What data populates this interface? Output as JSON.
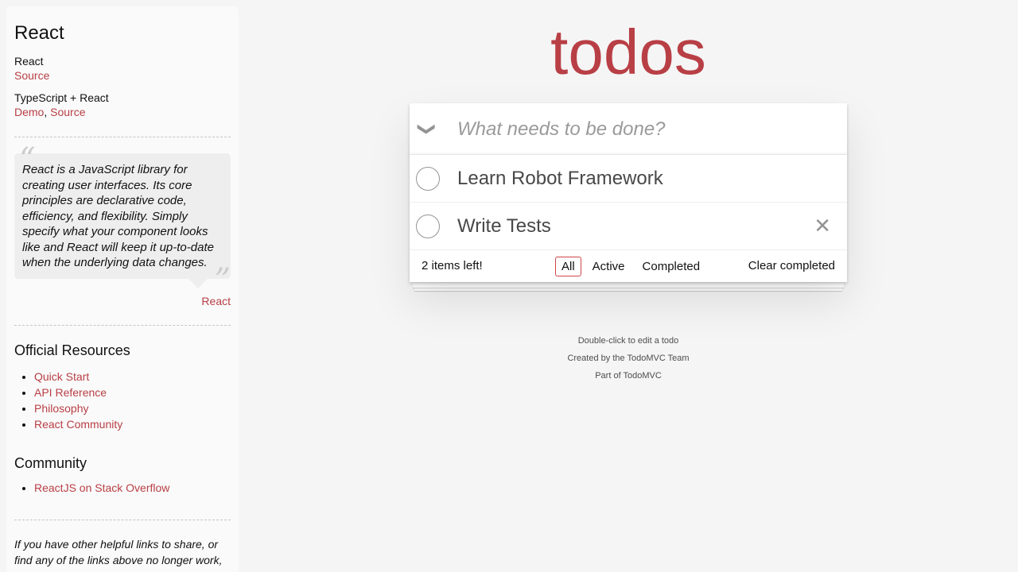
{
  "sidebar": {
    "title": "React",
    "examples": [
      {
        "name": "React",
        "links": [
          "Source"
        ]
      },
      {
        "name": "TypeScript + React",
        "links": [
          "Demo",
          "Source"
        ]
      }
    ],
    "quote": {
      "text": "React is a JavaScript library for creating user interfaces. Its core principles are declarative code, efficiency, and flexibility. Simply specify what your component looks like and React will keep it up-to-date when the underlying data changes.",
      "source": "React"
    },
    "official_resources": {
      "heading": "Official Resources",
      "items": [
        "Quick Start",
        "API Reference",
        "Philosophy",
        "React Community"
      ]
    },
    "community": {
      "heading": "Community",
      "items": [
        "ReactJS on Stack Overflow"
      ]
    },
    "footer_note": "If you have other helpful links to share, or find any of the links above no longer work, please let us know."
  },
  "app": {
    "title": "todos",
    "new_todo_placeholder": "What needs to be done?",
    "todos": [
      {
        "label": "Learn Robot Framework",
        "completed": false
      },
      {
        "label": "Write Tests",
        "completed": false
      }
    ],
    "footer": {
      "count": "2 items left!",
      "filters": [
        "All",
        "Active",
        "Completed"
      ],
      "selected_filter": "All",
      "clear_label": "Clear completed"
    }
  },
  "info": {
    "line1": "Double-click to edit a todo",
    "line2": "Created by the TodoMVC Team",
    "line3": "Part of TodoMVC"
  },
  "colors": {
    "accent": "#b83f45",
    "background": "#f5f5f5",
    "sidebar_bg": "#fafafa"
  }
}
